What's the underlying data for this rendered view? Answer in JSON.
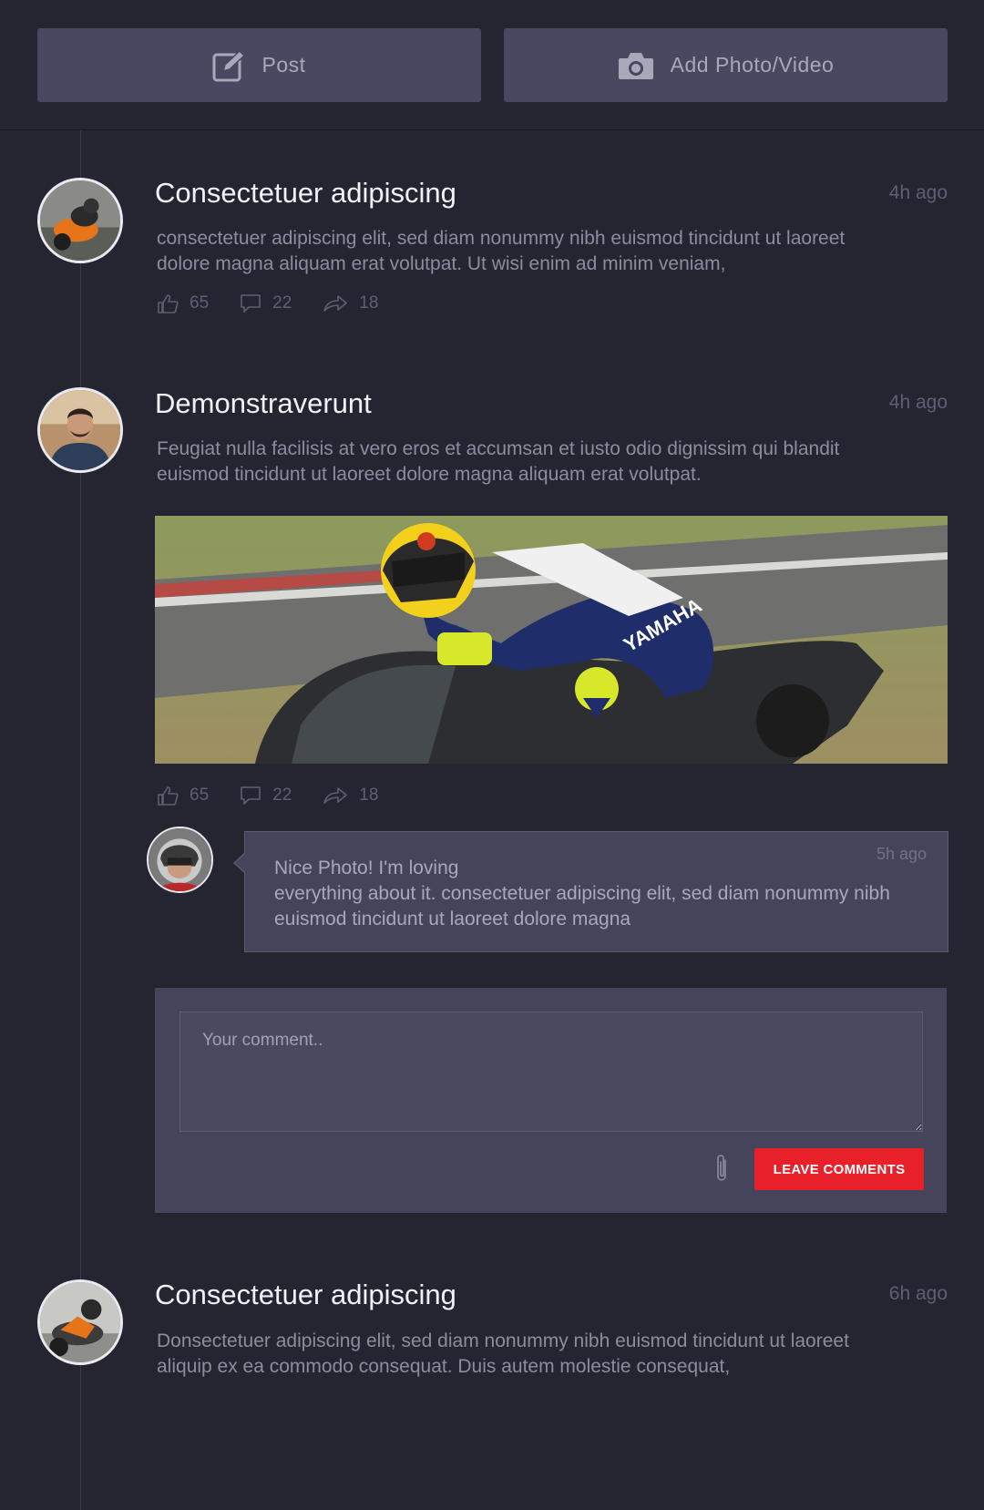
{
  "toolbar": {
    "post_label": "Post",
    "post_icon": "edit-icon",
    "media_label": "Add Photo/Video",
    "media_icon": "camera-icon"
  },
  "posts": [
    {
      "title": "Consectetuer adipiscing",
      "time": "4h ago",
      "body": "consectetuer adipiscing elit, sed diam nonummy nibh euismod tincidunt ut laoreet dolore magna aliquam erat volutpat. Ut wisi enim ad minim veniam,",
      "likes": "65",
      "comments": "22",
      "shares": "18"
    },
    {
      "title": "Demonstraverunt",
      "time": "4h ago",
      "body": "Feugiat nulla facilisis at vero eros et accumsan et iusto odio dignissim qui blandit euismod tincidunt ut laoreet dolore magna aliquam erat volutpat.",
      "likes": "65",
      "comments": "22",
      "shares": "18",
      "comment": {
        "time": "5h ago",
        "line1": "Nice Photo! I'm loving",
        "line2": "everything about it. consectetuer adipiscing elit, sed diam nonummy nibh euismod tincidunt ut laoreet dolore magna"
      }
    },
    {
      "title": "Consectetuer adipiscing",
      "time": "6h ago",
      "body": "Donsectetuer adipiscing elit, sed diam nonummy nibh euismod tincidunt ut  laoreet aliquip ex ea commodo consequat. Duis autem  molestie consequat,"
    }
  ],
  "comment_form": {
    "placeholder": "Your comment..",
    "submit_label": "LEAVE COMMENTS",
    "attach_icon": "paperclip-icon"
  },
  "colors": {
    "background": "#252532",
    "panel": "#45445a",
    "accent": "#e8202a"
  }
}
